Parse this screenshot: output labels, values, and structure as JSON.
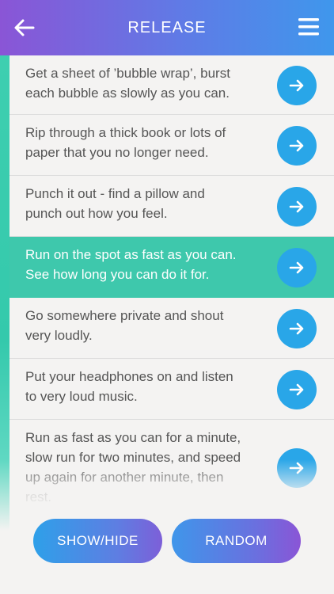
{
  "header": {
    "title": "RELEASE",
    "back_icon": "arrow-left-icon",
    "menu_icon": "hamburger-menu-icon"
  },
  "colors": {
    "header_gradient_start": "#8a55d6",
    "header_gradient_end": "#3f97ec",
    "accent_teal": "#3ec8ac",
    "arrow_button_blue": "#29a6e8",
    "text_gray": "#555555"
  },
  "items": [
    {
      "lines": [
        "Get a sheet of ’bubble wrap’, burst",
        "each bubble as slowly as you can."
      ],
      "selected": false,
      "icon": "arrow-right-icon"
    },
    {
      "lines": [
        "Rip through a thick book or lots of",
        "paper that you no longer need."
      ],
      "selected": false,
      "icon": "arrow-right-icon"
    },
    {
      "lines": [
        "Punch it out - find a pillow and",
        "punch out how you feel."
      ],
      "selected": false,
      "icon": "arrow-right-icon"
    },
    {
      "lines": [
        "Run on the spot as fast as you can.",
        "See how long you can do it for."
      ],
      "selected": true,
      "icon": "arrow-right-icon"
    },
    {
      "lines": [
        "Go somewhere private and shout",
        "very loudly."
      ],
      "selected": false,
      "icon": "arrow-right-icon"
    },
    {
      "lines": [
        "Put your headphones on and listen",
        "to very loud music."
      ],
      "selected": false,
      "icon": "arrow-right-icon"
    },
    {
      "lines": [
        "Run as fast as you can for a minute,",
        "slow run for two minutes, and speed",
        "up again for another minute, then",
        "rest."
      ],
      "selected": false,
      "icon": "arrow-right-icon"
    }
  ],
  "buttons": {
    "show_hide": "SHOW/HIDE",
    "random": "RANDOM"
  }
}
